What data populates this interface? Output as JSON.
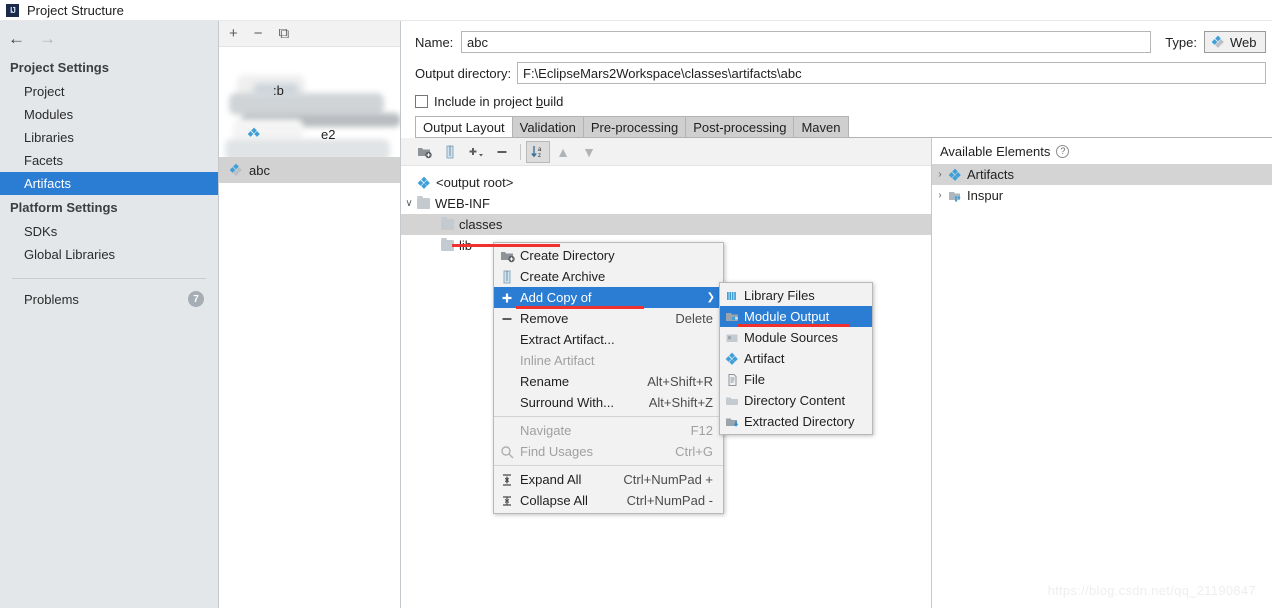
{
  "window": {
    "title": "Project Structure",
    "icon": "intellij-idea-icon"
  },
  "nav": {
    "back_icon": "arrow-left-icon",
    "forward_icon": "arrow-right-icon"
  },
  "sidebar": {
    "sections": [
      {
        "heading": "Project Settings",
        "items": [
          {
            "label": "Project",
            "selected": false
          },
          {
            "label": "Modules",
            "selected": false
          },
          {
            "label": "Libraries",
            "selected": false
          },
          {
            "label": "Facets",
            "selected": false
          },
          {
            "label": "Artifacts",
            "selected": true
          }
        ]
      },
      {
        "heading": "Platform Settings",
        "items": [
          {
            "label": "SDKs",
            "selected": false
          },
          {
            "label": "Global Libraries",
            "selected": false
          }
        ]
      }
    ],
    "problems": {
      "label": "Problems",
      "count": "7"
    }
  },
  "artifact_list": {
    "toolbar": [
      {
        "name": "add-artifact-button",
        "glyph": "+"
      },
      {
        "name": "remove-artifact-button",
        "glyph": "−"
      },
      {
        "name": "copy-artifact-button",
        "glyph": "⧉"
      }
    ],
    "items": [
      {
        "label": ":b",
        "blurred": true,
        "selected": false
      },
      {
        "label": "e2",
        "blurred": true,
        "selected": false
      },
      {
        "label": "abc",
        "blurred": false,
        "selected": true
      }
    ]
  },
  "form": {
    "name_label": "Name:",
    "name_value": "abc",
    "type_label": "Type:",
    "type_value": "Web",
    "outdir_label": "Output directory:",
    "outdir_value": "F:\\EclipseMars2Workspace\\classes\\artifacts\\abc",
    "include_label_pre": "Include in project ",
    "include_label_key": "b",
    "include_label_post": "uild",
    "include_checked": false
  },
  "tabs": [
    {
      "label": "Output Layout",
      "active": true
    },
    {
      "label": "Validation",
      "active": false
    },
    {
      "label": "Pre-processing",
      "active": false
    },
    {
      "label": "Post-processing",
      "active": false
    },
    {
      "label": "Maven",
      "active": false
    }
  ],
  "tree_toolbar": [
    {
      "name": "create-directory-button",
      "glyph": "▮",
      "state": "enabled"
    },
    {
      "name": "create-archive-button",
      "glyph": "▯",
      "state": "enabled"
    },
    {
      "name": "add-copy-button",
      "glyph": "+",
      "state": "enabled"
    },
    {
      "name": "remove-button",
      "glyph": "−",
      "state": "enabled"
    },
    {
      "name": "sort-alphabetically-button",
      "glyph": "↓az",
      "state": "pressed"
    },
    {
      "name": "move-up-button",
      "glyph": "▲",
      "state": "disabled"
    },
    {
      "name": "move-down-button",
      "glyph": "▼",
      "state": "disabled"
    }
  ],
  "tree": [
    {
      "label": "<output root>",
      "icon": "artifact-icon",
      "indent": 0,
      "twisty": "",
      "selected": false
    },
    {
      "label": "WEB-INF",
      "icon": "folder-icon",
      "indent": 0,
      "twisty": "∨",
      "selected": false
    },
    {
      "label": "classes",
      "icon": "folder-icon",
      "indent": 1,
      "twisty": "",
      "selected": true
    },
    {
      "label": "lib",
      "icon": "folder-icon",
      "indent": 1,
      "twisty": "",
      "selected": false
    }
  ],
  "available_elements": {
    "title": "Available Elements",
    "help_icon": "help-icon",
    "rows": [
      {
        "label": "Artifacts",
        "icon": "artifact-icon",
        "twisty": "›",
        "shaded": true
      },
      {
        "label": "Inspur",
        "icon": "module-icon",
        "twisty": "›",
        "shaded": false
      }
    ]
  },
  "context_menu": {
    "items": [
      {
        "label": "Create Directory",
        "shortcut": "",
        "icon": "new-folder-icon",
        "state": "enabled",
        "submenu": false
      },
      {
        "label": "Create Archive",
        "shortcut": "",
        "icon": "archive-icon",
        "state": "enabled",
        "submenu": false
      },
      {
        "label": "Add Copy of",
        "shortcut": "",
        "icon": "plus-icon",
        "state": "selected",
        "submenu": true
      },
      {
        "label": "Remove",
        "shortcut": "Delete",
        "icon": "minus-icon",
        "state": "enabled",
        "submenu": false
      },
      {
        "label": "Extract Artifact...",
        "shortcut": "",
        "icon": "",
        "state": "enabled",
        "submenu": false
      },
      {
        "label": "Inline Artifact",
        "shortcut": "",
        "icon": "",
        "state": "disabled",
        "submenu": false
      },
      {
        "label": "Rename",
        "shortcut": "Alt+Shift+R",
        "icon": "",
        "state": "enabled",
        "submenu": false
      },
      {
        "label": "Surround With...",
        "shortcut": "Alt+Shift+Z",
        "icon": "",
        "state": "enabled",
        "submenu": false
      },
      {
        "separator": true
      },
      {
        "label": "Navigate",
        "shortcut": "F12",
        "icon": "",
        "state": "disabled",
        "submenu": false
      },
      {
        "label": "Find Usages",
        "shortcut": "Ctrl+G",
        "icon": "search-icon",
        "state": "disabled",
        "submenu": false
      },
      {
        "separator": true
      },
      {
        "label": "Expand All",
        "shortcut": "Ctrl+NumPad +",
        "icon": "expand-all-icon",
        "state": "enabled",
        "submenu": false
      },
      {
        "label": "Collapse All",
        "shortcut": "Ctrl+NumPad -",
        "icon": "collapse-all-icon",
        "state": "enabled",
        "submenu": false
      }
    ]
  },
  "submenu": {
    "items": [
      {
        "label": "Library Files",
        "icon": "library-icon",
        "state": "enabled"
      },
      {
        "label": "Module Output",
        "icon": "module-output-icon",
        "state": "selected"
      },
      {
        "label": "Module Sources",
        "icon": "module-sources-icon",
        "state": "enabled"
      },
      {
        "label": "Artifact",
        "icon": "artifact-icon",
        "state": "enabled"
      },
      {
        "label": "File",
        "icon": "file-icon",
        "state": "enabled"
      },
      {
        "label": "Directory Content",
        "icon": "folder-icon",
        "state": "enabled"
      },
      {
        "label": "Extracted Directory",
        "icon": "extracted-directory-icon",
        "state": "enabled"
      }
    ]
  },
  "annotations": {
    "accent_red": "#f0312e",
    "highlight_blue": "#2b7cd3"
  },
  "watermark": "https://blog.csdn.net/qq_21190847"
}
